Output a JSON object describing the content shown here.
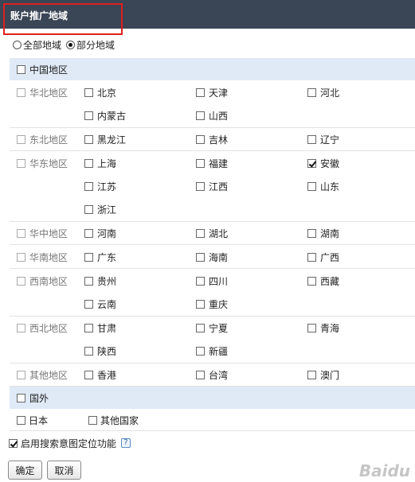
{
  "header": {
    "title": "账户推广地域"
  },
  "scope": {
    "options": [
      {
        "label": "全部地域",
        "selected": false
      },
      {
        "label": "部分地域",
        "selected": true
      }
    ]
  },
  "china": {
    "label": "中国地区",
    "checked": false,
    "regions": [
      {
        "name": "华北地区",
        "provinces": [
          {
            "name": "北京",
            "checked": false
          },
          {
            "name": "天津",
            "checked": false
          },
          {
            "name": "河北",
            "checked": false
          },
          {
            "name": "内蒙古",
            "checked": false
          },
          {
            "name": "山西",
            "checked": false
          }
        ]
      },
      {
        "name": "东北地区",
        "provinces": [
          {
            "name": "黑龙江",
            "checked": false
          },
          {
            "name": "吉林",
            "checked": false
          },
          {
            "name": "辽宁",
            "checked": false
          }
        ]
      },
      {
        "name": "华东地区",
        "provinces": [
          {
            "name": "上海",
            "checked": false
          },
          {
            "name": "福建",
            "checked": false
          },
          {
            "name": "安徽",
            "checked": true
          },
          {
            "name": "江苏",
            "checked": false
          },
          {
            "name": "江西",
            "checked": false
          },
          {
            "name": "山东",
            "checked": false
          },
          {
            "name": "浙江",
            "checked": false
          }
        ]
      },
      {
        "name": "华中地区",
        "provinces": [
          {
            "name": "河南",
            "checked": false
          },
          {
            "name": "湖北",
            "checked": false
          },
          {
            "name": "湖南",
            "checked": false
          }
        ]
      },
      {
        "name": "华南地区",
        "provinces": [
          {
            "name": "广东",
            "checked": false
          },
          {
            "name": "海南",
            "checked": false
          },
          {
            "name": "广西",
            "checked": false
          }
        ]
      },
      {
        "name": "西南地区",
        "provinces": [
          {
            "name": "贵州",
            "checked": false
          },
          {
            "name": "四川",
            "checked": false
          },
          {
            "name": "西藏",
            "checked": false
          },
          {
            "name": "云南",
            "checked": false
          },
          {
            "name": "重庆",
            "checked": false
          }
        ]
      },
      {
        "name": "西北地区",
        "provinces": [
          {
            "name": "甘肃",
            "checked": false
          },
          {
            "name": "宁夏",
            "checked": false
          },
          {
            "name": "青海",
            "checked": false
          },
          {
            "name": "陕西",
            "checked": false
          },
          {
            "name": "新疆",
            "checked": false
          }
        ]
      },
      {
        "name": "其他地区",
        "provinces": [
          {
            "name": "香港",
            "checked": false
          },
          {
            "name": "台湾",
            "checked": false
          },
          {
            "name": "澳门",
            "checked": false
          }
        ]
      }
    ]
  },
  "foreign": {
    "label": "国外",
    "checked": false,
    "items": [
      {
        "name": "日本",
        "checked": false
      },
      {
        "name": "其他国家",
        "checked": false
      }
    ]
  },
  "intent": {
    "label": "启用搜索意图定位功能",
    "checked": true,
    "help": "?"
  },
  "buttons": {
    "ok": "确定",
    "cancel": "取消"
  },
  "watermark": "Baidu"
}
